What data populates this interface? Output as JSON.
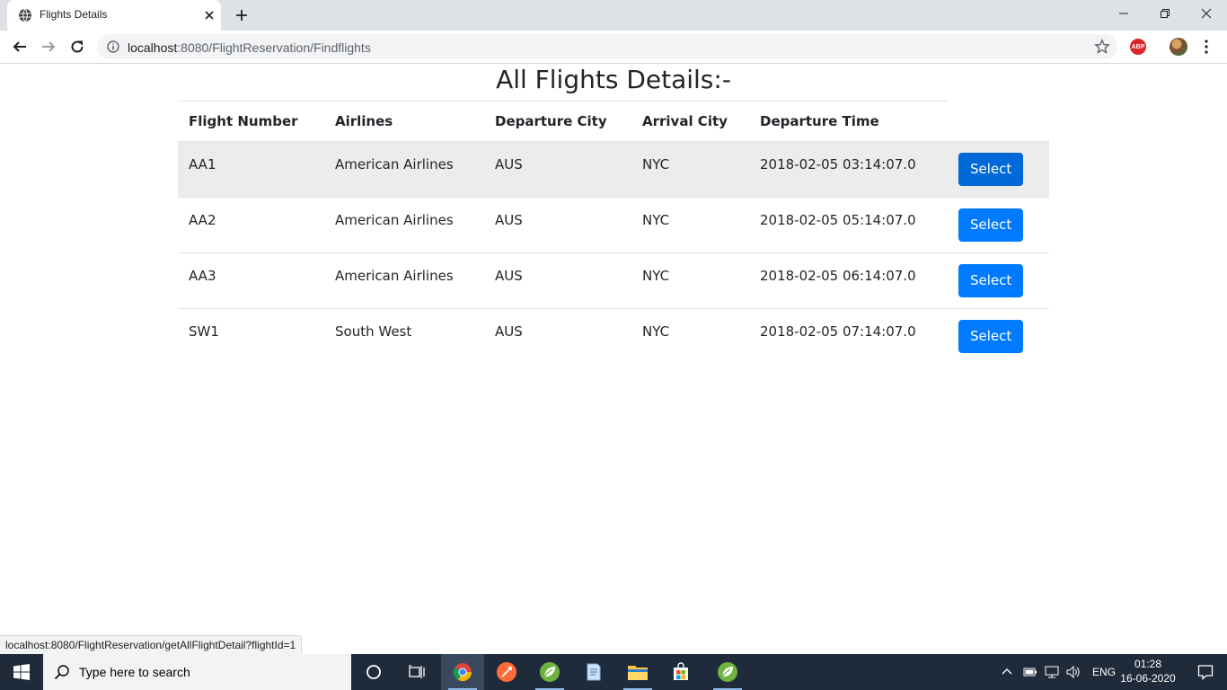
{
  "browser": {
    "tab_title": "Flights Details",
    "url_host": "localhost",
    "url_rest": ":8080/FlightReservation/Findflights",
    "status_url": "localhost:8080/FlightReservation/getAllFlightDetail?flightId=1",
    "extension_label": "ABP"
  },
  "page": {
    "title": "All Flights Details:-",
    "columns": [
      "Flight Number",
      "Airlines",
      "Departure City",
      "Arrival City",
      "Departure Time"
    ],
    "select_label": "Select",
    "hovered_row": 0,
    "rows": [
      {
        "flight_number": "AA1",
        "airline": "American Airlines",
        "departure_city": "AUS",
        "arrival_city": "NYC",
        "departure_time": "2018-02-05 03:14:07.0"
      },
      {
        "flight_number": "AA2",
        "airline": "American Airlines",
        "departure_city": "AUS",
        "arrival_city": "NYC",
        "departure_time": "2018-02-05 05:14:07.0"
      },
      {
        "flight_number": "AA3",
        "airline": "American Airlines",
        "departure_city": "AUS",
        "arrival_city": "NYC",
        "departure_time": "2018-02-05 06:14:07.0"
      },
      {
        "flight_number": "SW1",
        "airline": "South West",
        "departure_city": "AUS",
        "arrival_city": "NYC",
        "departure_time": "2018-02-05 07:14:07.0"
      }
    ]
  },
  "taskbar": {
    "search_placeholder": "Type here to search",
    "language": "ENG",
    "time": "01:28",
    "date": "16-06-2020"
  },
  "colors": {
    "primary_button": "#007bff",
    "hover_row": "#ececec",
    "taskbar": "#1f2b3a"
  }
}
